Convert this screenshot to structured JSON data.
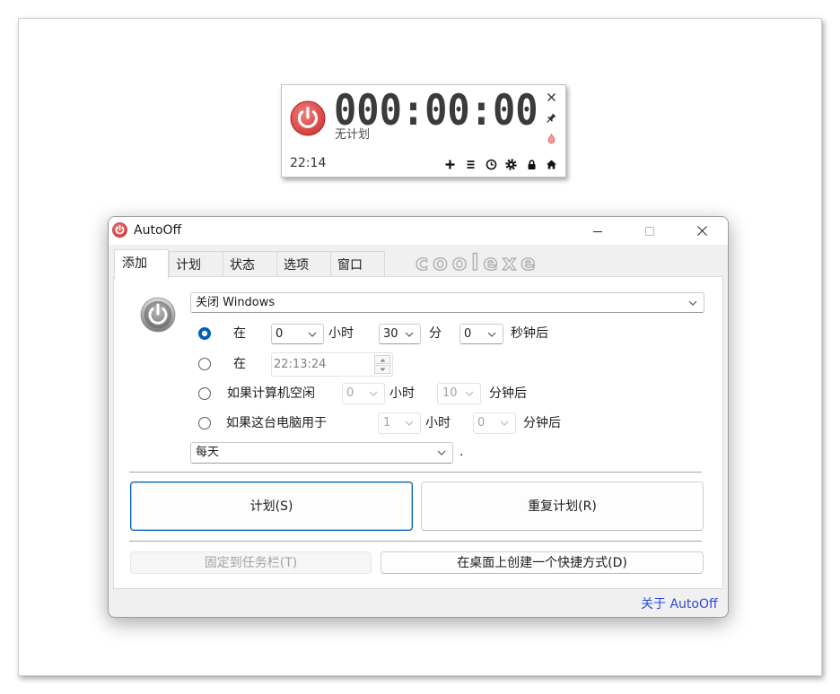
{
  "colors": {
    "accent": "#005fb8",
    "power_red": "#d23a3a",
    "link": "#2a4bd7",
    "disabled_text": "#a3a3a3"
  },
  "widget": {
    "timer": "000:00:00",
    "status": "无计划",
    "clock": "22:14",
    "side_icons": [
      "close-icon",
      "pin-icon",
      "drop-icon"
    ],
    "toolbar_icons": [
      "add-icon",
      "list-icon",
      "clock-icon",
      "gear-icon",
      "lock-icon",
      "home-icon"
    ]
  },
  "window": {
    "title": "AutoOff",
    "tabs": [
      {
        "label": "添加",
        "active": true
      },
      {
        "label": "计划",
        "active": false
      },
      {
        "label": "状态",
        "active": false
      },
      {
        "label": "选项",
        "active": false
      },
      {
        "label": "窗口",
        "active": false
      }
    ],
    "logo_text": "coolexe",
    "action": {
      "selected": "关闭 Windows"
    },
    "options": [
      {
        "checked": true,
        "label": "在",
        "hours": "0",
        "hours_unit": "小时",
        "minutes": "30",
        "minutes_unit": "分",
        "seconds": "0",
        "seconds_unit": "秒钟后"
      },
      {
        "checked": false,
        "label": "在",
        "time": "22:13:24"
      },
      {
        "checked": false,
        "label": "如果计算机空闲",
        "hours": "0",
        "hours_unit": "小时",
        "minutes": "10",
        "minutes_unit": "分钟后"
      },
      {
        "checked": false,
        "label": "如果这台电脑用于",
        "hours": "1",
        "hours_unit": "小时",
        "minutes": "0",
        "minutes_unit": "分钟后"
      }
    ],
    "repeat": {
      "selected": "每天",
      "suffix": "."
    },
    "buttons": {
      "schedule": "计划(S)",
      "repeat_schedule": "重复计划(R)",
      "pin_taskbar": "固定到任务栏(T)",
      "desktop_shortcut": "在桌面上创建一个快捷方式(D)"
    },
    "about_link": "关于 AutoOff"
  }
}
